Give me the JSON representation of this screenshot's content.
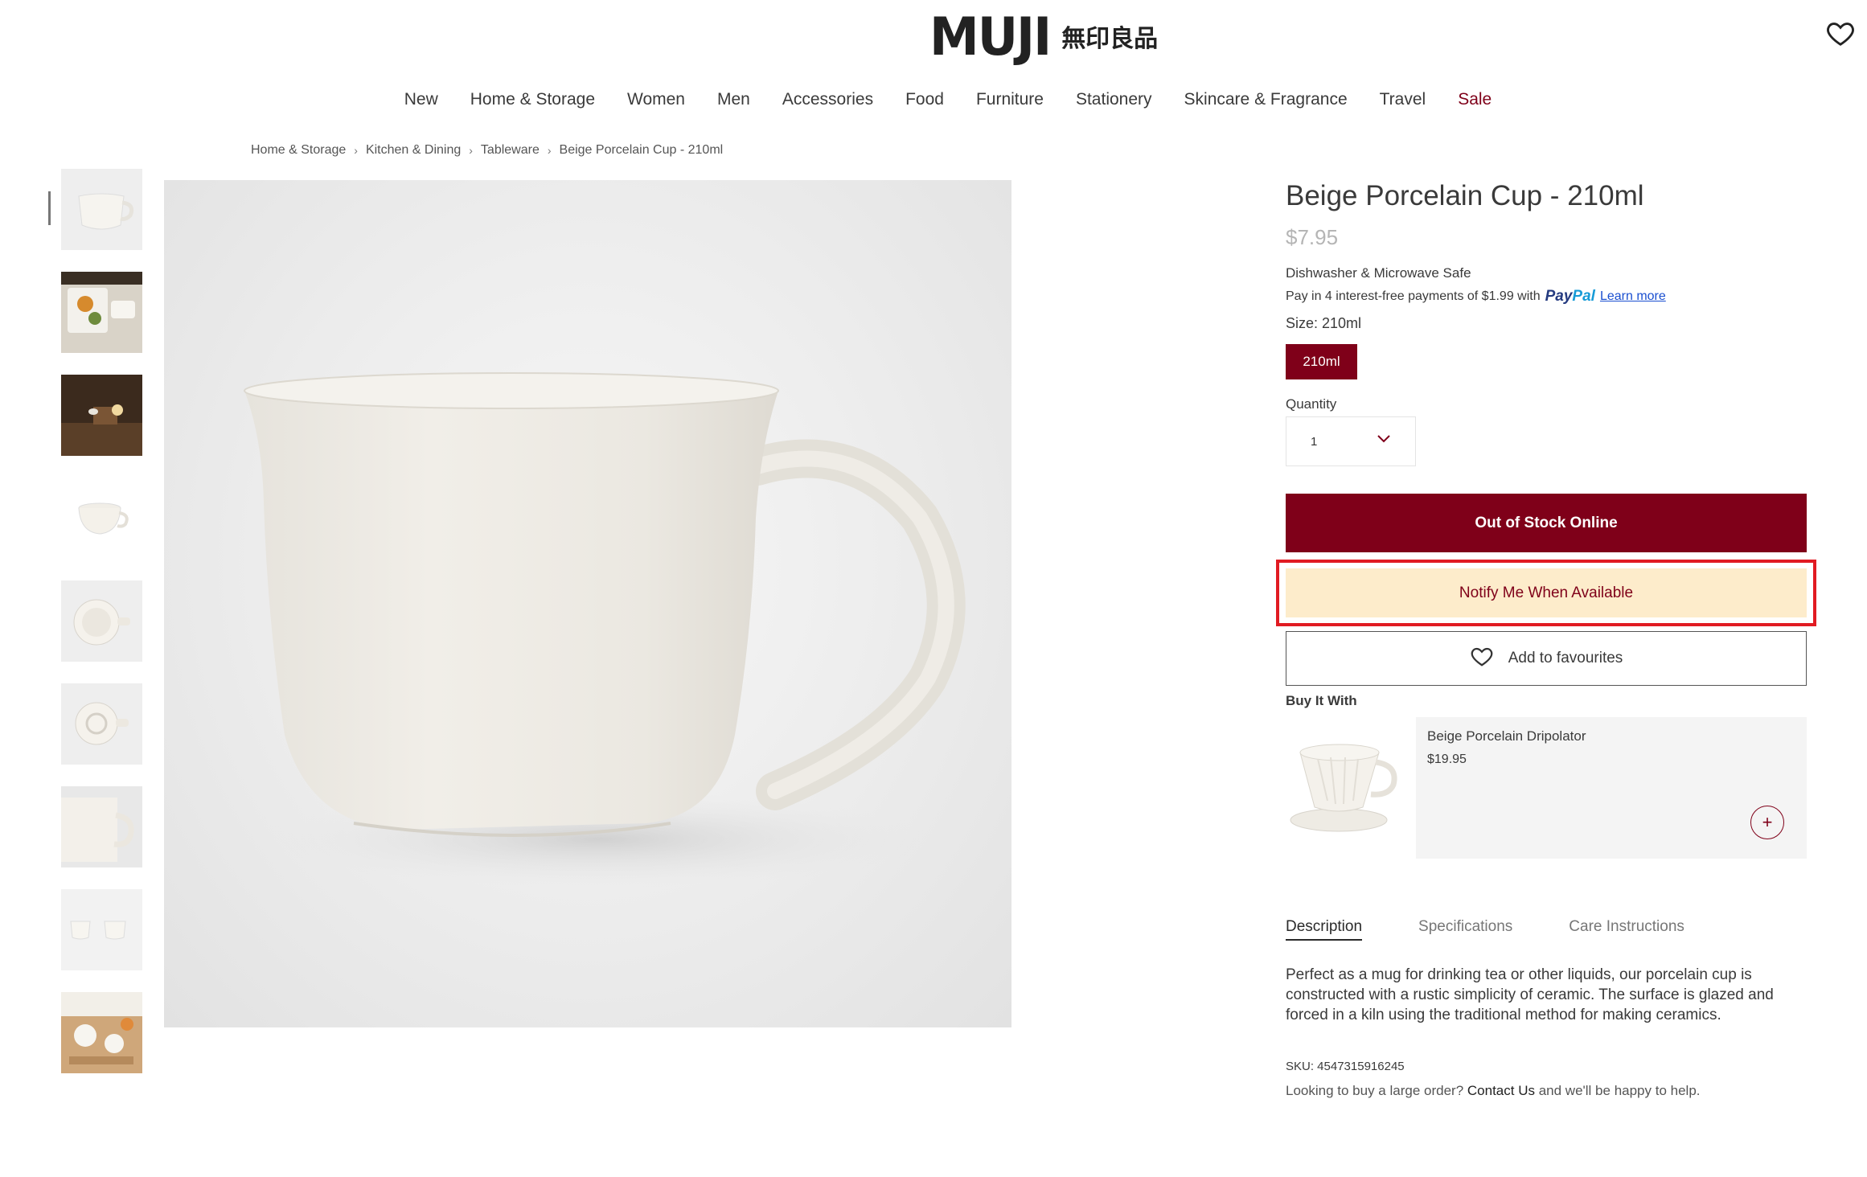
{
  "header": {
    "logo_main": "MUJI",
    "logo_sub": "無印良品"
  },
  "nav": [
    {
      "label": "New"
    },
    {
      "label": "Home & Storage"
    },
    {
      "label": "Women"
    },
    {
      "label": "Men"
    },
    {
      "label": "Accessories"
    },
    {
      "label": "Food"
    },
    {
      "label": "Furniture"
    },
    {
      "label": "Stationery"
    },
    {
      "label": "Skincare & Fragrance"
    },
    {
      "label": "Travel"
    },
    {
      "label": "Sale"
    }
  ],
  "breadcrumb": {
    "items": [
      "Home & Storage",
      "Kitchen & Dining",
      "Tableware"
    ],
    "separator": "›",
    "current": "Beige Porcelain Cup - 210ml"
  },
  "gallery": {
    "thumb_count": 9,
    "selected_index": 0
  },
  "product": {
    "title": "Beige Porcelain Cup - 210ml",
    "price": "$7.95",
    "feature": "Dishwasher & Microwave Safe",
    "paypal_text": "Pay in 4 interest-free payments of $1.99 with",
    "paypal_brand_a": "Pay",
    "paypal_brand_b": "Pal",
    "learn_more": "Learn more",
    "size_label": "Size: 210ml",
    "size_option": "210ml",
    "quantity_label": "Quantity",
    "quantity_value": "1",
    "oos_button": "Out of Stock Online",
    "notify_button": "Notify Me When Available",
    "favourite_button": "Add to favourites"
  },
  "buy_it_with": {
    "label": "Buy It With",
    "name": "Beige Porcelain Dripolator",
    "price": "$19.95",
    "add_symbol": "+"
  },
  "tabs": [
    {
      "label": "Description",
      "active": true
    },
    {
      "label": "Specifications",
      "active": false
    },
    {
      "label": "Care Instructions",
      "active": false
    }
  ],
  "description": "Perfect as a mug for drinking tea or other liquids, our porcelain cup is constructed with a rustic simplicity of ceramic. The surface is glazed and forced in a kiln using the traditional method for making ceramics.",
  "sku": "SKU: 4547315916245",
  "bulk": {
    "before": "Looking to buy a large order?",
    "link": "Contact Us",
    "after": "and we'll be happy to help."
  },
  "colors": {
    "brand": "#7f0019",
    "notify_bg": "#fdeccb",
    "highlight": "#e11b22"
  }
}
